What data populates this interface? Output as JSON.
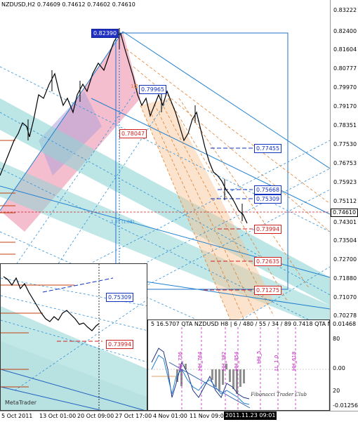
{
  "window": {
    "header": "NZDUSD,H2  0.74609  0.74612  0.74602  0.74610"
  },
  "price_axis": [
    "0.83222",
    "0.82400",
    "0.81604",
    "0.80777",
    "0.79970",
    "0.79170",
    "0.78351",
    "0.77530",
    "0.76753",
    "0.75923",
    "0.75112",
    "0.74610",
    "0.74301",
    "0.73504",
    "0.72700",
    "0.71880",
    "0.71070",
    "0.70278"
  ],
  "current_price": "0.74610",
  "time_axis": [
    "5 Oct 2011",
    "13 Oct 01:00",
    "20 Oct 09:00",
    "27 Oct 17:00",
    "4 Nov 01:00",
    "11 Nov 09:00"
  ],
  "time_cursor": "2011.11.23 09:01",
  "price_marks": {
    "m1": "0.82390",
    "m2": "0.79965",
    "m3": "0.78047",
    "m4": "0.77455",
    "m5": "0.75668",
    "m6": "0.75309",
    "m7": "0.73994",
    "m8": "0.72635",
    "m9": "0.71275"
  },
  "chart_notes": {
    "level": "1.0T (1.08)"
  },
  "inset": {
    "brand": "MetaTrader",
    "mark_a": "0.75309",
    "mark_b": "0.73994"
  },
  "indicator": {
    "header": "5 16.5707  QTA  NZDUSD  H8  | 6 / 480 / 55 / 34 / 89  0.7418  QTA  NZDU",
    "axis": [
      "0.01468",
      "80",
      "0.00",
      "20",
      "-0.01256"
    ],
    "signature": "Fibonacci Trader Club",
    "vlabels": [
      "HH_736",
      "HH_764",
      "HH_382",
      "HH_854",
      "HH_5",
      "LL_1.0",
      "HH_618"
    ]
  },
  "colors": {
    "pink_band": "#f0a0b8",
    "teal_band": "#88d0d0",
    "blue_line": "#2080d0",
    "orange": "#e08030",
    "red_label": "#d02020",
    "navy_label": "#1030c0"
  }
}
